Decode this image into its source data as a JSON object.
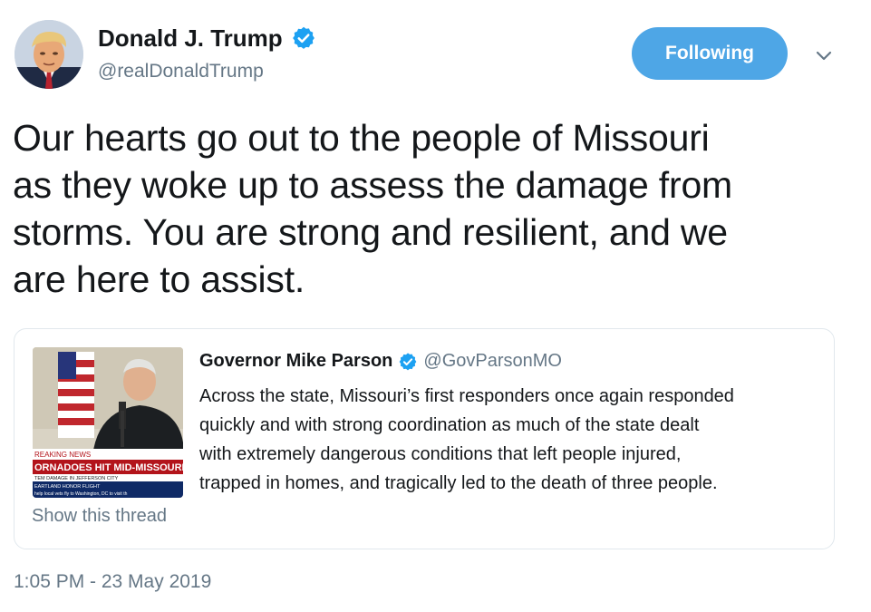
{
  "author": {
    "name": "Donald J. Trump",
    "handle": "@realDonaldTrump",
    "avatar_icon": "avatar-photo",
    "verified_icon": "verified-badge-icon",
    "verified_color": "#1da1f2"
  },
  "follow_button": {
    "label": "Following",
    "bg_color": "#4ea6e6"
  },
  "menu_icon": "chevron-down-icon",
  "tweet": {
    "lines": [
      "Our hearts go out to the people of Missouri",
      "as they woke up to assess the damage from",
      "storms. You are strong and resilient, and we",
      "are here to assist."
    ]
  },
  "quoted_tweet": {
    "author_name": "Governor Mike Parson",
    "author_handle": "@GovParsonMO",
    "verified_icon": "verified-badge-icon",
    "media": {
      "banner_lines": [
        "REAKING NEWS",
        "ORNADOES HIT MID-MISSOURI",
        "TEM DAMAGE IN JEFFERSON CITY",
        "EARTLAND HONOR FLIGHT",
        "help local vets fly to Washington, DC to visit th"
      ]
    },
    "lines": [
      "Across the state, Missouri’s first responders once again responded",
      "quickly and with strong coordination as much of the state dealt",
      "with extremely dangerous conditions that left people injured,",
      "trapped in homes, and tragically led to the death of three people."
    ],
    "show_thread_label": "Show this thread"
  },
  "timestamp": "1:05 PM - 23 May 2019"
}
